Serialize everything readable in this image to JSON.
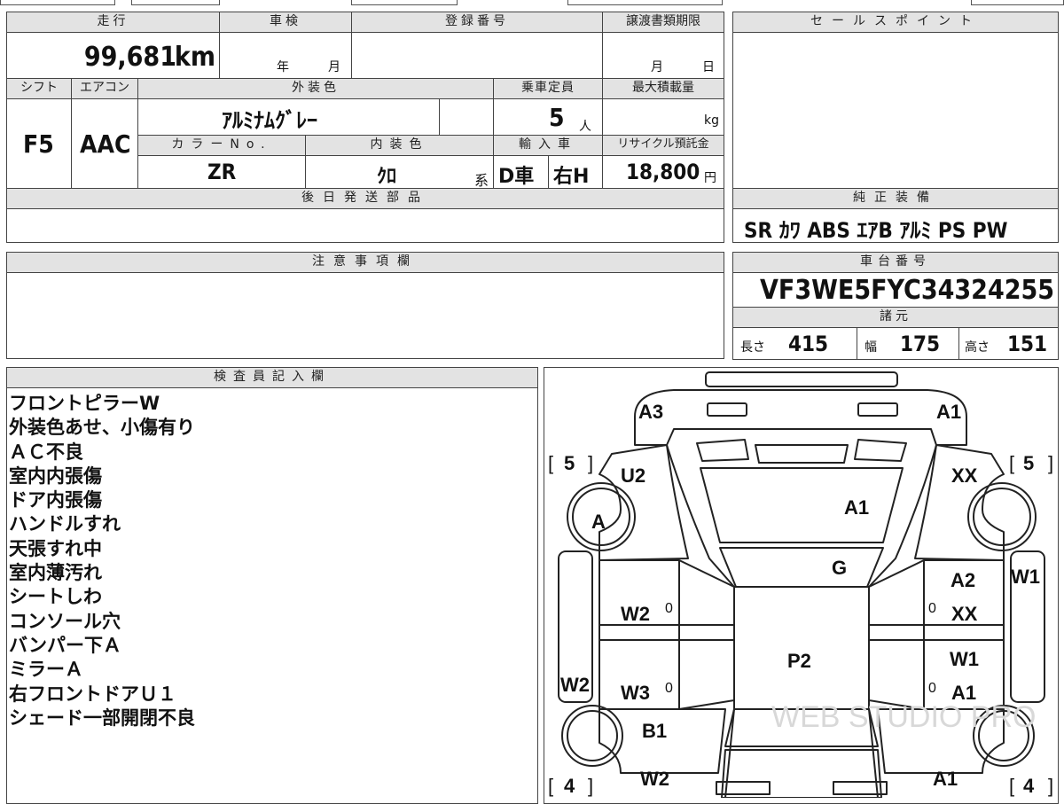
{
  "vehicle": {
    "mileage_label": "走行",
    "mileage_value": "99,681",
    "mileage_unit": "km",
    "inspection_label": "車検",
    "inspection_year": "年",
    "inspection_month": "月",
    "registration_label": "登録番号",
    "transfer_label": "譲渡書類期限",
    "transfer_month": "月",
    "transfer_day": "日",
    "shift_label": "シフト",
    "shift_value": "F5",
    "ac_label": "エアコン",
    "ac_value": "AAC",
    "exterior_label": "外装色",
    "exterior_value": "ｱﾙﾐﾅﾑｸﾞﾚｰ",
    "capacity_label": "乗車定員",
    "capacity_value": "5",
    "capacity_unit": "人",
    "maxload_label": "最大積載量",
    "maxload_unit": "kg",
    "color_no_label": "カラーNo.",
    "color_no_value": "ZR",
    "interior_label": "内装色",
    "interior_value": "ｸﾛ",
    "interior_suffix": "系",
    "import_label": "輸入車",
    "import_value": "D車",
    "handle_value": "右H",
    "recycle_label": "リサイクル預託金",
    "recycle_value": "18,800",
    "recycle_unit": "円",
    "later_parts_label": "後日発送部品"
  },
  "sales_point_label": "セールスポイント",
  "equipment": {
    "label": "純正装備",
    "items": "SR ｶﾜ ABS ｴｱB ｱﾙﾐ PS PW"
  },
  "caution_label": "注意事項欄",
  "chassis": {
    "label": "車台番号",
    "value": "VF3WE5FYC34324255"
  },
  "specs": {
    "label": "諸元",
    "length_label": "長さ",
    "length_value": "415",
    "width_label": "幅",
    "width_value": "175",
    "height_label": "高さ",
    "height_value": "151"
  },
  "inspector": {
    "label": "検査員記入欄",
    "notes": [
      "フロントピラーW",
      "外装色あせ、小傷有り",
      "ＡＣ不良",
      "室内内張傷",
      "ドア内張傷",
      "ハンドルすれ",
      "天張すれ中",
      "室内薄汚れ",
      "シートしわ",
      "コンソール穴",
      "バンパー下Ａ",
      "ミラーＡ",
      "右フロントドアＵ１",
      "シェード一部開閉不良"
    ]
  },
  "diagram": {
    "marks": {
      "front_left_bumper": "A3",
      "front_right_bumper": "A1",
      "front_left_fender": "U2",
      "front_right_fender": "XX",
      "bonnet": "A1",
      "front_left_wheel": "A",
      "windshield": "G",
      "right_front_door": "A2",
      "right_front_door2": "XX",
      "right_front_glass": "W1",
      "left_front_door": "W2",
      "roof": "P2",
      "right_rear_door": "W1",
      "right_rear_door2": "A1",
      "left_side_glass": "W2",
      "left_rear_door": "W3",
      "rear_left_fender": "B1",
      "rear_left_bumper": "W2",
      "rear_right_bumper": "A1"
    },
    "zeros": [
      "0",
      "0",
      "0",
      "0"
    ],
    "tire_front_left": "5",
    "tire_front_right": "5",
    "tire_rear_left": "4",
    "tire_rear_right": "4",
    "bracket_open": "[",
    "bracket_close": "]",
    "watermark": "WEB STUDIO PRO"
  }
}
